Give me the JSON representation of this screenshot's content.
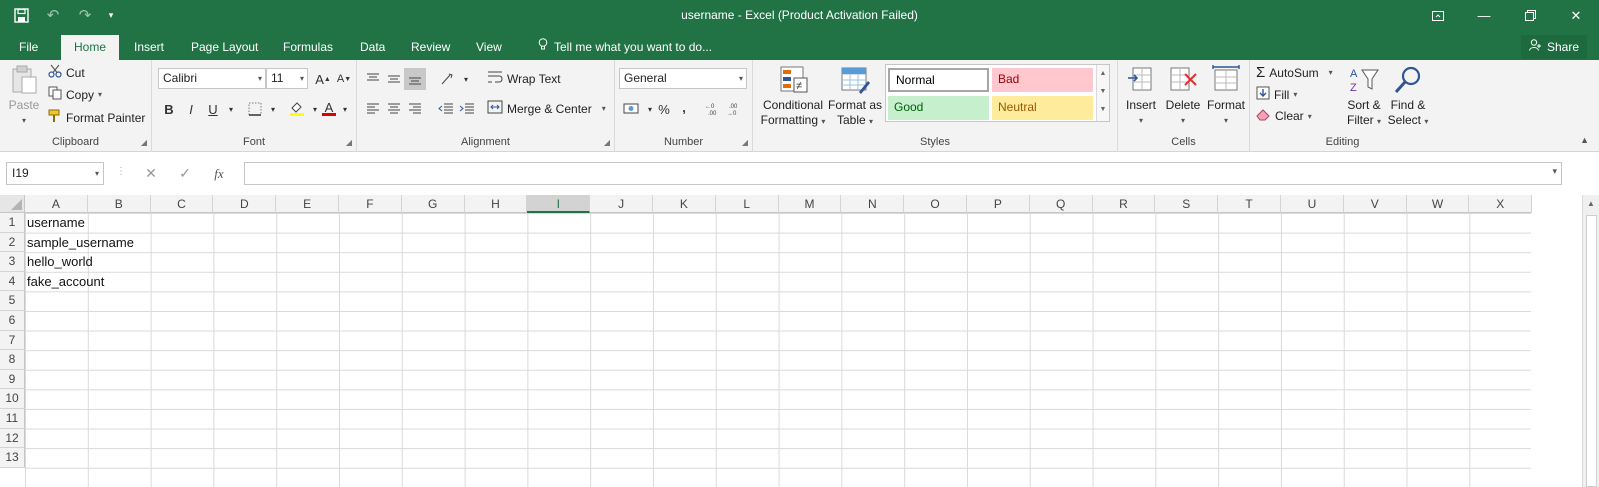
{
  "window": {
    "title": "username - Excel (Product Activation Failed)"
  },
  "tabs": [
    {
      "label": "File"
    },
    {
      "label": "Home"
    },
    {
      "label": "Insert"
    },
    {
      "label": "Page Layout"
    },
    {
      "label": "Formulas"
    },
    {
      "label": "Data"
    },
    {
      "label": "Review"
    },
    {
      "label": "View"
    }
  ],
  "tellme": {
    "label": "Tell me what you want to do..."
  },
  "share": {
    "label": "Share"
  },
  "ribbon": {
    "clipboard": {
      "label": "Clipboard",
      "paste": "Paste",
      "cut": "Cut",
      "copy": "Copy",
      "format_painter": "Format Painter"
    },
    "font": {
      "label": "Font",
      "family": "Calibri",
      "size": "11",
      "bold": "B",
      "italic": "I",
      "underline": "U",
      "grow": "A",
      "shrink": "A",
      "color_a": "A"
    },
    "alignment": {
      "label": "Alignment",
      "wrap_text": "Wrap Text",
      "merge_center": "Merge & Center"
    },
    "number": {
      "label": "Number",
      "format": "General",
      "percent": "%",
      "comma": ","
    },
    "styles": {
      "label": "Styles",
      "conditional_formatting_1": "Conditional",
      "conditional_formatting_2": "Formatting",
      "format_as_table_1": "Format as",
      "format_as_table_2": "Table",
      "normal": "Normal",
      "bad": "Bad",
      "good": "Good",
      "neutral": "Neutral"
    },
    "cells": {
      "label": "Cells",
      "insert": "Insert",
      "delete": "Delete",
      "format": "Format"
    },
    "editing": {
      "label": "Editing",
      "autosum": "AutoSum",
      "fill": "Fill",
      "clear": "Clear",
      "sort_filter_1": "Sort &",
      "sort_filter_2": "Filter",
      "find_select_1": "Find &",
      "find_select_2": "Select"
    }
  },
  "formula_bar": {
    "name_box": "I19",
    "fx": "fx",
    "content": ""
  },
  "sheet": {
    "columns": [
      "A",
      "B",
      "C",
      "D",
      "E",
      "F",
      "G",
      "H",
      "I",
      "J",
      "K",
      "L",
      "M",
      "N",
      "O",
      "P",
      "Q",
      "R",
      "S",
      "T",
      "U",
      "V",
      "W",
      "X"
    ],
    "selected_column": "I",
    "rows": [
      "1",
      "2",
      "3",
      "4",
      "5",
      "6",
      "7",
      "8",
      "9",
      "10",
      "11",
      "12",
      "13"
    ],
    "cells": [
      {
        "ref": "A1",
        "value": "username"
      },
      {
        "ref": "A2",
        "value": "sample_username"
      },
      {
        "ref": "A3",
        "value": "hello_world"
      },
      {
        "ref": "A4",
        "value": "fake_account"
      }
    ]
  },
  "colors": {
    "brand": "#217346",
    "bad_bg": "#ffc7ce",
    "bad_fg": "#9c0006",
    "good_bg": "#c6efce",
    "good_fg": "#006100",
    "neutral_bg": "#ffeb9c",
    "neutral_fg": "#9c5700"
  }
}
